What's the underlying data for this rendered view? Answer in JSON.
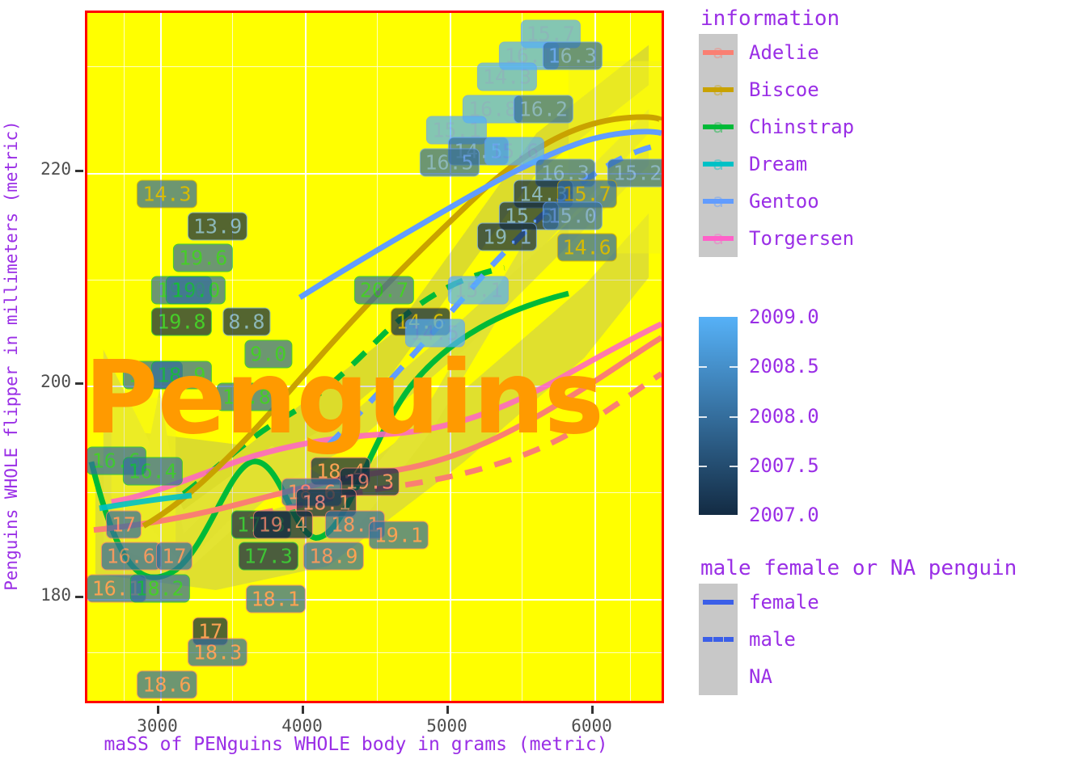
{
  "axes": {
    "x_label": "maSS of PENguins WHOLE body in grams (metric)",
    "y_label": "Penguins WHOLE flipper in millimeters (metric)",
    "x_ticks": [
      "3000",
      "4000",
      "5000",
      "6000"
    ],
    "y_ticks": [
      "180",
      "200",
      "220"
    ],
    "tick_color": "#4D4D4D",
    "label_color": "#9A2EE6"
  },
  "panel": {
    "background": "#FFFF00",
    "border_color": "#FF0000",
    "grid_color": "#FFFFFF",
    "watermark": "Penguins",
    "watermark_color": "#FF9A00"
  },
  "legends": {
    "species": {
      "title": "information",
      "key_background": "#C8C8C8",
      "key_glyph": "a",
      "items": [
        {
          "label": "Adelie",
          "color": "#FA7F72"
        },
        {
          "label": "Biscoe",
          "color": "#C9A200"
        },
        {
          "label": "Chinstrap",
          "color": "#00BA38"
        },
        {
          "label": "Dream",
          "color": "#00C1C6"
        },
        {
          "label": "Gentoo",
          "color": "#619CFF"
        },
        {
          "label": "Torgersen",
          "color": "#FF61C9"
        }
      ]
    },
    "colorbar": {
      "ticks": [
        "2009.0",
        "2008.5",
        "2008.0",
        "2007.5",
        "2007.0"
      ],
      "low_color": "#132B43",
      "high_color": "#56B1F7"
    },
    "linetype": {
      "title": "male female or NA penguin",
      "key_background": "#C8C8C8",
      "line_color": "#3B5FE8",
      "items": [
        {
          "label": "female",
          "style": "solid"
        },
        {
          "label": "male",
          "style": "dashed"
        },
        {
          "label": "NA",
          "style": "none"
        }
      ]
    }
  },
  "chart_data": {
    "type": "scatter",
    "title": "Penguins",
    "xlabel": "maSS of PENguins WHOLE body in grams (metric)",
    "ylabel": "Penguins WHOLE flipper in millimeters (metric)",
    "xlim": [
      2500,
      6500
    ],
    "ylim": [
      170,
      235
    ],
    "grid": true,
    "legend_position": "right",
    "point_label_field": "bill depth (mm)",
    "color_field": "year",
    "text_color_field": "species / island",
    "linetype_field": "sex",
    "species_colors": {
      "Adelie": "#FA7F72",
      "Biscoe": "#C9A200",
      "Chinstrap": "#00BA38",
      "Dream": "#00C1C6",
      "Gentoo": "#619CFF",
      "Torgersen": "#FF61C9"
    },
    "points": [
      {
        "x": 5700,
        "y": 233,
        "label": "15.7",
        "group": "Gentoo",
        "year": 2009
      },
      {
        "x": 5550,
        "y": 231,
        "label": "16.1",
        "group": "Gentoo",
        "year": 2009
      },
      {
        "x": 5850,
        "y": 231,
        "label": "16.3",
        "group": "Gentoo",
        "year": 2008
      },
      {
        "x": 5400,
        "y": 229,
        "label": "14.3",
        "group": "Gentoo",
        "year": 2009
      },
      {
        "x": 5300,
        "y": 226,
        "label": "16.8",
        "group": "Gentoo",
        "year": 2009
      },
      {
        "x": 5650,
        "y": 226,
        "label": "16.2",
        "group": "Gentoo",
        "year": 2008
      },
      {
        "x": 5050,
        "y": 224,
        "label": "15.1",
        "group": "Gentoo",
        "year": 2009
      },
      {
        "x": 5200,
        "y": 222,
        "label": "14.5",
        "group": "Gentoo",
        "year": 2008
      },
      {
        "x": 5450,
        "y": 222,
        "label": "15.6",
        "group": "Gentoo",
        "year": 2009
      },
      {
        "x": 5000,
        "y": 221,
        "label": "16.5",
        "group": "Gentoo",
        "year": 2008
      },
      {
        "x": 6300,
        "y": 220,
        "label": "15.2",
        "group": "Gentoo",
        "year": 2008
      },
      {
        "x": 5800,
        "y": 220,
        "label": "16.3",
        "group": "Gentoo",
        "year": 2008
      },
      {
        "x": 5650,
        "y": 218,
        "label": "14.3",
        "group": "Gentoo",
        "year": 2007
      },
      {
        "x": 5950,
        "y": 218,
        "label": "15.7",
        "group": "Biscoe",
        "year": 2008
      },
      {
        "x": 3050,
        "y": 218,
        "label": "14.3",
        "group": "Biscoe",
        "year": 2008
      },
      {
        "x": 5550,
        "y": 216,
        "label": "15.5",
        "group": "Gentoo",
        "year": 2007
      },
      {
        "x": 5850,
        "y": 216,
        "label": "15.0",
        "group": "Gentoo",
        "year": 2008
      },
      {
        "x": 3400,
        "y": 215,
        "label": "13.9",
        "group": "Gentoo",
        "year": 2007
      },
      {
        "x": 5400,
        "y": 214,
        "label": "19.1",
        "group": "Gentoo",
        "year": 2007
      },
      {
        "x": 5950,
        "y": 213,
        "label": "14.6",
        "group": "Biscoe",
        "year": 2008
      },
      {
        "x": 3300,
        "y": 212,
        "label": "19.6",
        "group": "Chinstrap",
        "year": 2008
      },
      {
        "x": 3150,
        "y": 209,
        "label": "19.0",
        "group": "Chinstrap",
        "year": 2008
      },
      {
        "x": 3250,
        "y": 209,
        "label": "19.0",
        "group": "Chinstrap",
        "year": 2008
      },
      {
        "x": 4550,
        "y": 209,
        "label": "20.7",
        "group": "Chinstrap",
        "year": 2008
      },
      {
        "x": 5200,
        "y": 209,
        "label": "15.1",
        "group": "Gentoo",
        "year": 2009
      },
      {
        "x": 3150,
        "y": 206,
        "label": "19.8",
        "group": "Chinstrap",
        "year": 2007
      },
      {
        "x": 3600,
        "y": 206,
        "label": "8.8",
        "group": "Gentoo",
        "year": 2007
      },
      {
        "x": 4800,
        "y": 206,
        "label": "14.6",
        "group": "Biscoe",
        "year": 2007
      },
      {
        "x": 4900,
        "y": 205,
        "label": "14.5",
        "group": "Gentoo",
        "year": 2009
      },
      {
        "x": 3750,
        "y": 203,
        "label": "9.0",
        "group": "Chinstrap",
        "year": 2008
      },
      {
        "x": 2950,
        "y": 201,
        "label": "18.1",
        "group": "Chinstrap",
        "year": 2008
      },
      {
        "x": 3150,
        "y": 201,
        "label": "18.9",
        "group": "Chinstrap",
        "year": 2008
      },
      {
        "x": 3600,
        "y": 199,
        "label": "18.8",
        "group": "Chinstrap",
        "year": 2008
      },
      {
        "x": 2700,
        "y": 193,
        "label": "16.6",
        "group": "Chinstrap",
        "year": 2008
      },
      {
        "x": 2950,
        "y": 192,
        "label": "16.4",
        "group": "Chinstrap",
        "year": 2008
      },
      {
        "x": 4250,
        "y": 192,
        "label": "18.4",
        "group": "Adelie",
        "year": 2007
      },
      {
        "x": 4450,
        "y": 191,
        "label": "19.3",
        "group": "Adelie",
        "year": 2007
      },
      {
        "x": 4050,
        "y": 190,
        "label": "18.6",
        "group": "Adelie",
        "year": 2008
      },
      {
        "x": 4150,
        "y": 189,
        "label": "18.1",
        "group": "Adelie",
        "year": 2007
      },
      {
        "x": 2750,
        "y": 187,
        "label": "17",
        "group": "Adelie",
        "year": 2008
      },
      {
        "x": 3700,
        "y": 187,
        "label": "17.3",
        "group": "Chinstrap",
        "year": 2007
      },
      {
        "x": 3850,
        "y": 187,
        "label": "19.4",
        "group": "Adelie",
        "year": 2007
      },
      {
        "x": 4350,
        "y": 187,
        "label": "18.1",
        "group": "Adelie",
        "year": 2008
      },
      {
        "x": 4650,
        "y": 186,
        "label": "19.1",
        "group": "Adelie",
        "year": 2008
      },
      {
        "x": 2800,
        "y": 184,
        "label": "16.6",
        "group": "Adelie",
        "year": 2008
      },
      {
        "x": 3100,
        "y": 184,
        "label": "17",
        "group": "Adelie",
        "year": 2008
      },
      {
        "x": 3750,
        "y": 184,
        "label": "17.3",
        "group": "Chinstrap",
        "year": 2007
      },
      {
        "x": 4200,
        "y": 184,
        "label": "18.9",
        "group": "Adelie",
        "year": 2008
      },
      {
        "x": 2700,
        "y": 181,
        "label": "16.1",
        "group": "Adelie",
        "year": 2008
      },
      {
        "x": 3000,
        "y": 181,
        "label": "18.2",
        "group": "Chinstrap",
        "year": 2008
      },
      {
        "x": 3800,
        "y": 180,
        "label": "18.1",
        "group": "Adelie",
        "year": 2008
      },
      {
        "x": 3350,
        "y": 177,
        "label": "17",
        "group": "Adelie",
        "year": 2007
      },
      {
        "x": 3400,
        "y": 175,
        "label": "18.3",
        "group": "Adelie",
        "year": 2008
      },
      {
        "x": 3050,
        "y": 172,
        "label": "18.6",
        "group": "Adelie",
        "year": 2008
      }
    ],
    "smooth_curves": [
      {
        "group": "Chinstrap",
        "sex": "female",
        "style": "solid"
      },
      {
        "group": "Chinstrap",
        "sex": "male",
        "style": "dashed"
      },
      {
        "group": "Adelie",
        "sex": "female",
        "style": "solid"
      },
      {
        "group": "Adelie",
        "sex": "male",
        "style": "dashed"
      },
      {
        "group": "Gentoo",
        "sex": "female",
        "style": "solid"
      },
      {
        "group": "Gentoo",
        "sex": "male",
        "style": "dashed"
      },
      {
        "group": "Biscoe",
        "sex": "female",
        "style": "solid"
      },
      {
        "group": "Torgersen",
        "sex": "female",
        "style": "solid"
      }
    ]
  }
}
